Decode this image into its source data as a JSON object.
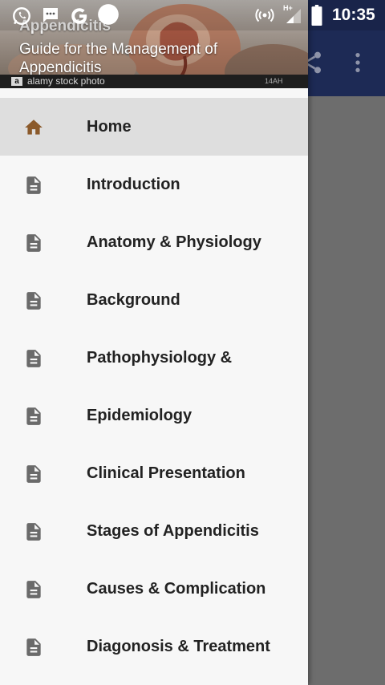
{
  "status_bar": {
    "time": "10:35",
    "network_label": "H+",
    "left_icons": [
      "whatsapp-icon",
      "message-icon",
      "google-icon",
      "circle-icon"
    ],
    "right_icons": [
      "hotspot-icon",
      "signal-icon",
      "battery-icon"
    ]
  },
  "app_toolbar": {
    "actions": [
      "share-icon",
      "more-vert-icon"
    ],
    "color": "#1d2a55"
  },
  "drawer": {
    "header": {
      "title": "Appendicitis",
      "subtitle": "Guide for the Management of Appendicitis",
      "watermark_badge": "a",
      "watermark": "alamy stock photo",
      "watermark_id": "14AH"
    },
    "items": [
      {
        "label": "Home",
        "icon": "home-icon",
        "active": true
      },
      {
        "label": "Introduction",
        "icon": "document-icon"
      },
      {
        "label": "Anatomy & Physiology",
        "icon": "document-icon"
      },
      {
        "label": "Background",
        "icon": "document-icon"
      },
      {
        "label": "Pathophysiology &",
        "icon": "document-icon"
      },
      {
        "label": "Epidemiology",
        "icon": "document-icon"
      },
      {
        "label": "Clinical Presentation",
        "icon": "document-icon"
      },
      {
        "label": "Stages of Appendicitis",
        "icon": "document-icon"
      },
      {
        "label": "Causes & Complication",
        "icon": "document-icon"
      },
      {
        "label": "Diagonosis & Treatment",
        "icon": "document-icon"
      }
    ],
    "colors": {
      "active_bg": "#dedede",
      "home_icon": "#8b5a2b",
      "doc_icon": "#6a6a6a",
      "text": "#222222"
    }
  }
}
